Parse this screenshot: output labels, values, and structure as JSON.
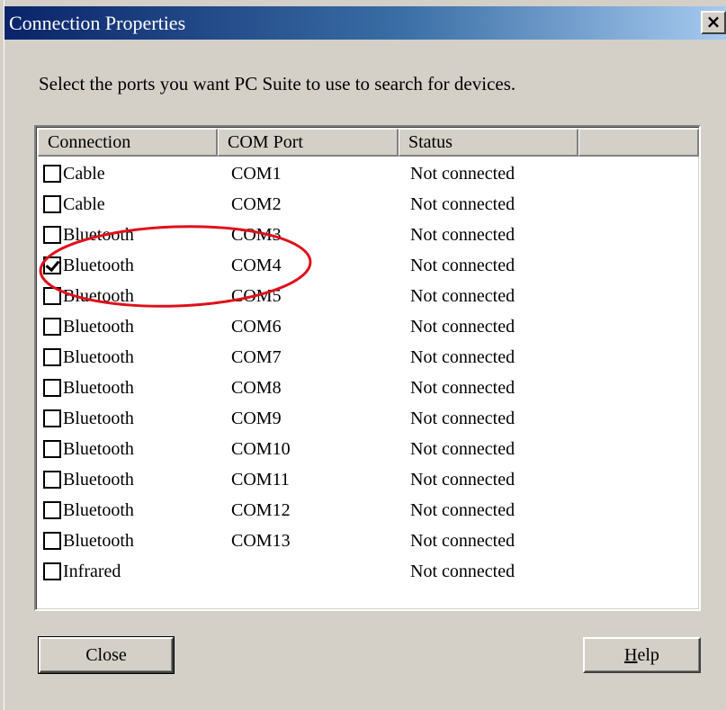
{
  "window": {
    "title": "Connection Properties",
    "close_glyph": "×"
  },
  "instruction": "Select the ports you want PC Suite to use to search for devices.",
  "list": {
    "columns": [
      "Connection",
      "COM Port",
      "Status"
    ],
    "rows": [
      {
        "connection": "Cable",
        "port": "COM1",
        "status": "Not connected",
        "checked": false
      },
      {
        "connection": "Cable",
        "port": "COM2",
        "status": "Not connected",
        "checked": false
      },
      {
        "connection": "Bluetooth",
        "port": "COM3",
        "status": "Not connected",
        "checked": false
      },
      {
        "connection": "Bluetooth",
        "port": "COM4",
        "status": "Not connected",
        "checked": true
      },
      {
        "connection": "Bluetooth",
        "port": "COM5",
        "status": "Not connected",
        "checked": false
      },
      {
        "connection": "Bluetooth",
        "port": "COM6",
        "status": "Not connected",
        "checked": false
      },
      {
        "connection": "Bluetooth",
        "port": "COM7",
        "status": "Not connected",
        "checked": false
      },
      {
        "connection": "Bluetooth",
        "port": "COM8",
        "status": "Not connected",
        "checked": false
      },
      {
        "connection": "Bluetooth",
        "port": "COM9",
        "status": "Not connected",
        "checked": false
      },
      {
        "connection": "Bluetooth",
        "port": "COM10",
        "status": "Not connected",
        "checked": false
      },
      {
        "connection": "Bluetooth",
        "port": "COM11",
        "status": "Not connected",
        "checked": false
      },
      {
        "connection": "Bluetooth",
        "port": "COM12",
        "status": "Not connected",
        "checked": false
      },
      {
        "connection": "Bluetooth",
        "port": "COM13",
        "status": "Not connected",
        "checked": false
      },
      {
        "connection": "Infrared",
        "port": "",
        "status": "Not connected",
        "checked": false
      }
    ]
  },
  "buttons": {
    "close_label": "Close",
    "help_first": "H",
    "help_rest": "elp"
  },
  "colors": {
    "title_gradient_start": "#0a246a",
    "title_gradient_end": "#a6caf0",
    "annotation": "#e0101a"
  }
}
